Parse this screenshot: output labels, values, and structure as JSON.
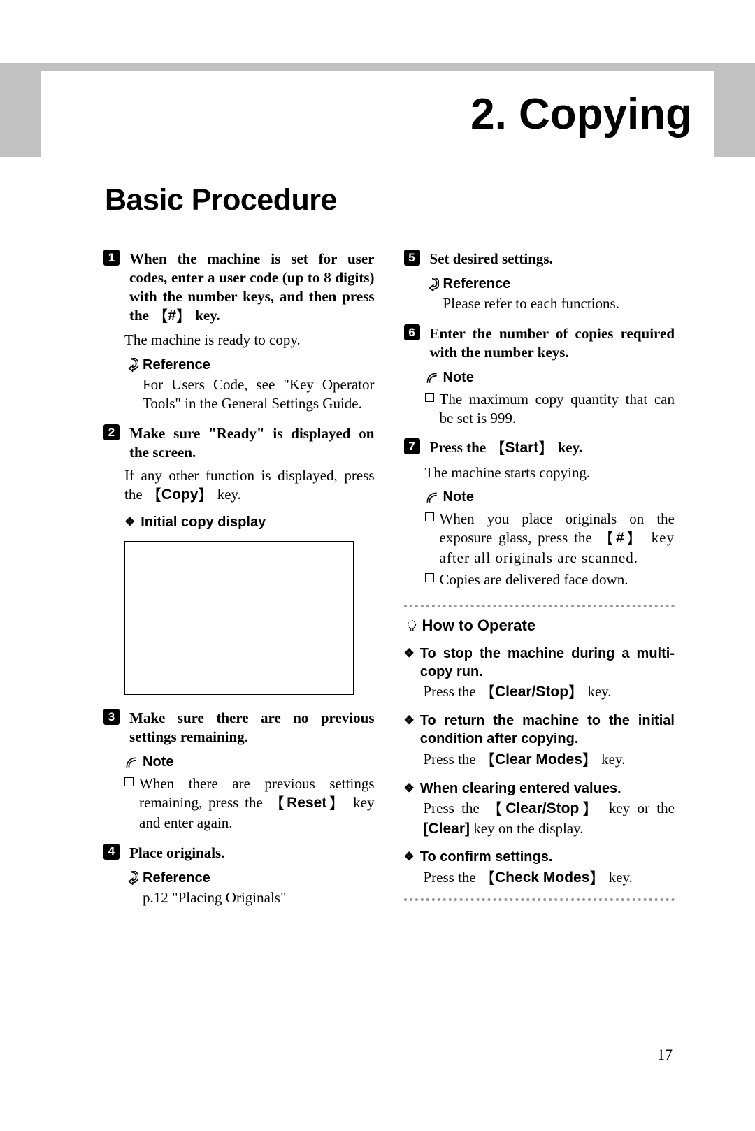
{
  "chapter": {
    "title": "2. Copying"
  },
  "section": {
    "title": "Basic Procedure"
  },
  "left": {
    "s1": {
      "num": "1",
      "bold": "When the machine is set for user codes, enter a user code (up to 8 digits) with the number keys, and then press the",
      "key1_pre": "【",
      "key1": "#",
      "key1_post": "】",
      "bold_tail": " key.",
      "after": "The machine is ready to copy.",
      "ref_label": "Reference",
      "ref_text": "For Users Code, see    \"Key Operator Tools\" in the General Settings Guide."
    },
    "s2": {
      "num": "2",
      "bold": "Make sure \"Ready\" is displayed on the screen.",
      "after": "If any other function is displayed, press the ",
      "key_pre": "【",
      "key": "Copy",
      "key_post": "】",
      "after_tail": " key.",
      "diamond": "Initial copy display"
    },
    "s3": {
      "num": "3",
      "bold": "Make sure there are no previous settings remaining.",
      "note_label": "Note",
      "note_text_pre": "When there are previous settings remaining, press the ",
      "key_pre": "【",
      "key": "Reset",
      "key_post": "】",
      "note_text_post": " key and enter again."
    },
    "s4": {
      "num": "4",
      "bold": "Place originals.",
      "ref_label": "Reference",
      "ref_text": "p.12 \"Placing Originals\""
    }
  },
  "right": {
    "s5": {
      "num": "5",
      "bold": "Set desired settings.",
      "ref_label": "Reference",
      "ref_text": "Please refer to each functions."
    },
    "s6": {
      "num": "6",
      "bold": "Enter the number of copies required with the number keys.",
      "note_label": "Note",
      "note_text": "The maximum copy quantity that can be set is 999."
    },
    "s7": {
      "num": "7",
      "bold_pre": "Press the ",
      "key_pre": "【",
      "key": "Start",
      "key_post": "】",
      "bold_post": " key.",
      "after": "The machine starts copying.",
      "note_label": "Note",
      "n1_pre": "When you place originals on the exposure glass, press the ",
      "n1_key_pre": "【",
      "n1_key": "#",
      "n1_key_post": "】",
      "n1_post": " key after all originals are scanned.",
      "n2": "Copies are delivered face down."
    },
    "how": {
      "title": "How to Operate",
      "t1": {
        "head": "To stop the machine during a multi-copy run.",
        "body_pre": "Press the ",
        "key_pre": "【",
        "key": "Clear/Stop",
        "key_post": "】",
        "body_post": " key."
      },
      "t2": {
        "head": "To return the machine to the initial condition after copying.",
        "body_pre": "Press the ",
        "key_pre": "【",
        "key": "Clear Modes",
        "key_post": "】",
        "body_post": " key."
      },
      "t3": {
        "head": "When clearing entered values.",
        "body_pre": "Press the ",
        "key_pre": "【",
        "key": "Clear/Stop",
        "key_post": "】",
        "body_mid": " key or the ",
        "key2": "[Clear]",
        "body_post": " key on the display."
      },
      "t4": {
        "head": "To confirm settings.",
        "body_pre": "Press the ",
        "key_pre": "【",
        "key": "Check Modes",
        "key_post": "】",
        "body_post": " key."
      }
    }
  },
  "page_number": "17"
}
